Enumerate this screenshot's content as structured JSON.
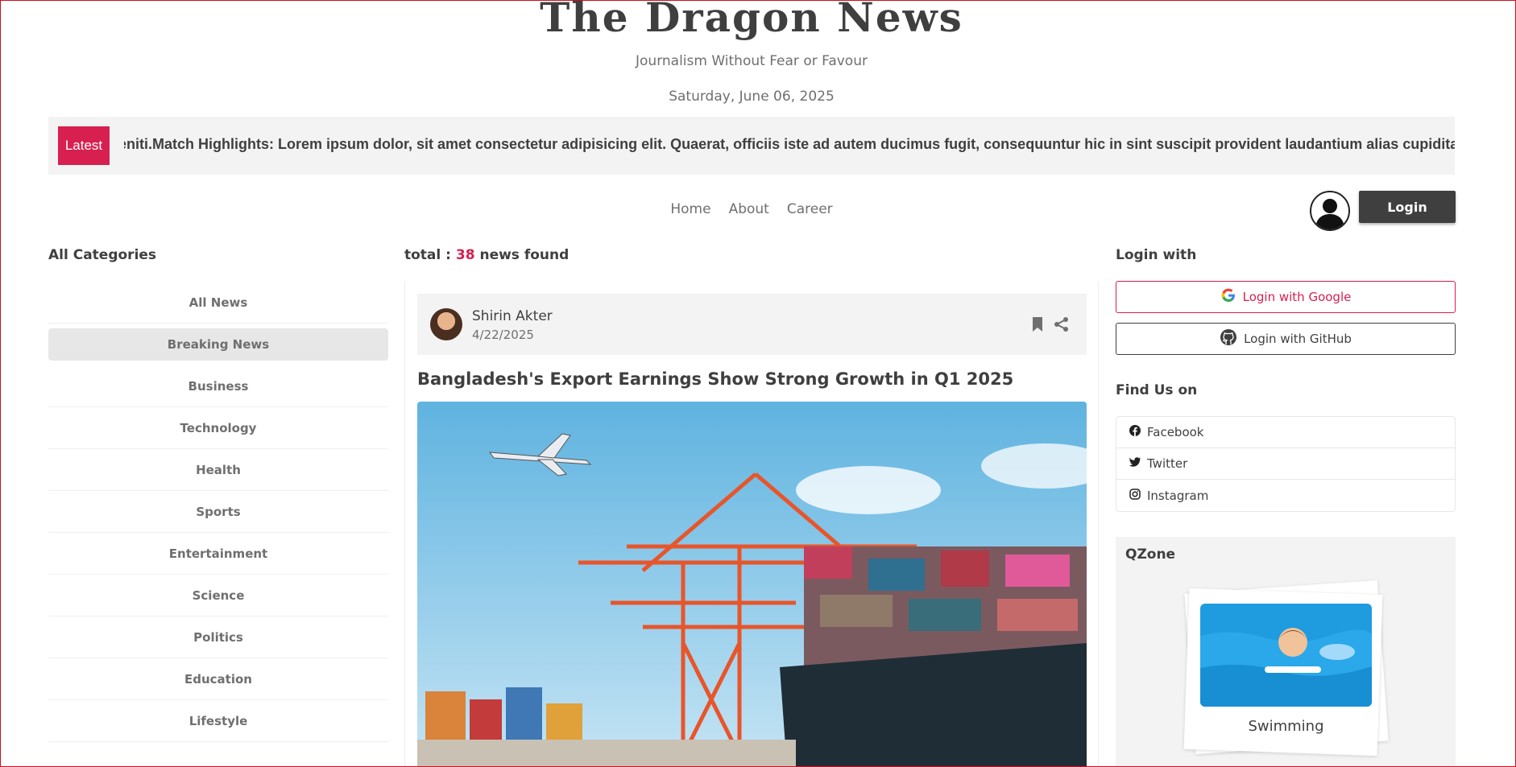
{
  "header": {
    "title": "The Dragon News",
    "tagline": "Journalism Without Fear or Favour",
    "date": "Saturday, June 06, 2025"
  },
  "ticker": {
    "badge": "Latest",
    "text": "leniti.Match Highlights: Lorem ipsum dolor, sit amet consectetur adipisicing elit. Quaerat, officiis iste ad autem ducimus fugit, consequuntur hic in sint suscipit provident laudantium alias cupiditate mo"
  },
  "nav": {
    "items": [
      {
        "label": "Home"
      },
      {
        "label": "About"
      },
      {
        "label": "Career"
      }
    ],
    "login_label": "Login"
  },
  "left": {
    "title": "All Categories",
    "categories": [
      {
        "label": "All News"
      },
      {
        "label": "Breaking News"
      },
      {
        "label": "Business"
      },
      {
        "label": "Technology"
      },
      {
        "label": "Health"
      },
      {
        "label": "Sports"
      },
      {
        "label": "Entertainment"
      },
      {
        "label": "Science"
      },
      {
        "label": "Politics"
      },
      {
        "label": "Education"
      },
      {
        "label": "Lifestyle"
      }
    ],
    "active_index": 1
  },
  "main": {
    "total_prefix": "total :",
    "total_count": "38",
    "total_suffix": "news found",
    "card": {
      "author": "Shirin Akter",
      "date": "4/22/2025",
      "title": "Bangladesh's Export Earnings Show Strong Growth in Q1 2025",
      "image_icon": "cargo-port-image"
    }
  },
  "right": {
    "login_title": "Login with",
    "google_label": "Login with Google",
    "github_label": "Login with GitHub",
    "find_title": "Find Us on",
    "social": [
      {
        "label": "Facebook",
        "icon": "facebook-icon"
      },
      {
        "label": "Twitter",
        "icon": "twitter-icon"
      },
      {
        "label": "Instagram",
        "icon": "instagram-icon"
      }
    ],
    "qzone_title": "QZone",
    "qzone_label": "Swimming"
  },
  "colors": {
    "accent": "#d72050",
    "dark": "#403f3f",
    "muted": "#706f6f",
    "panel": "#f3f3f3"
  }
}
